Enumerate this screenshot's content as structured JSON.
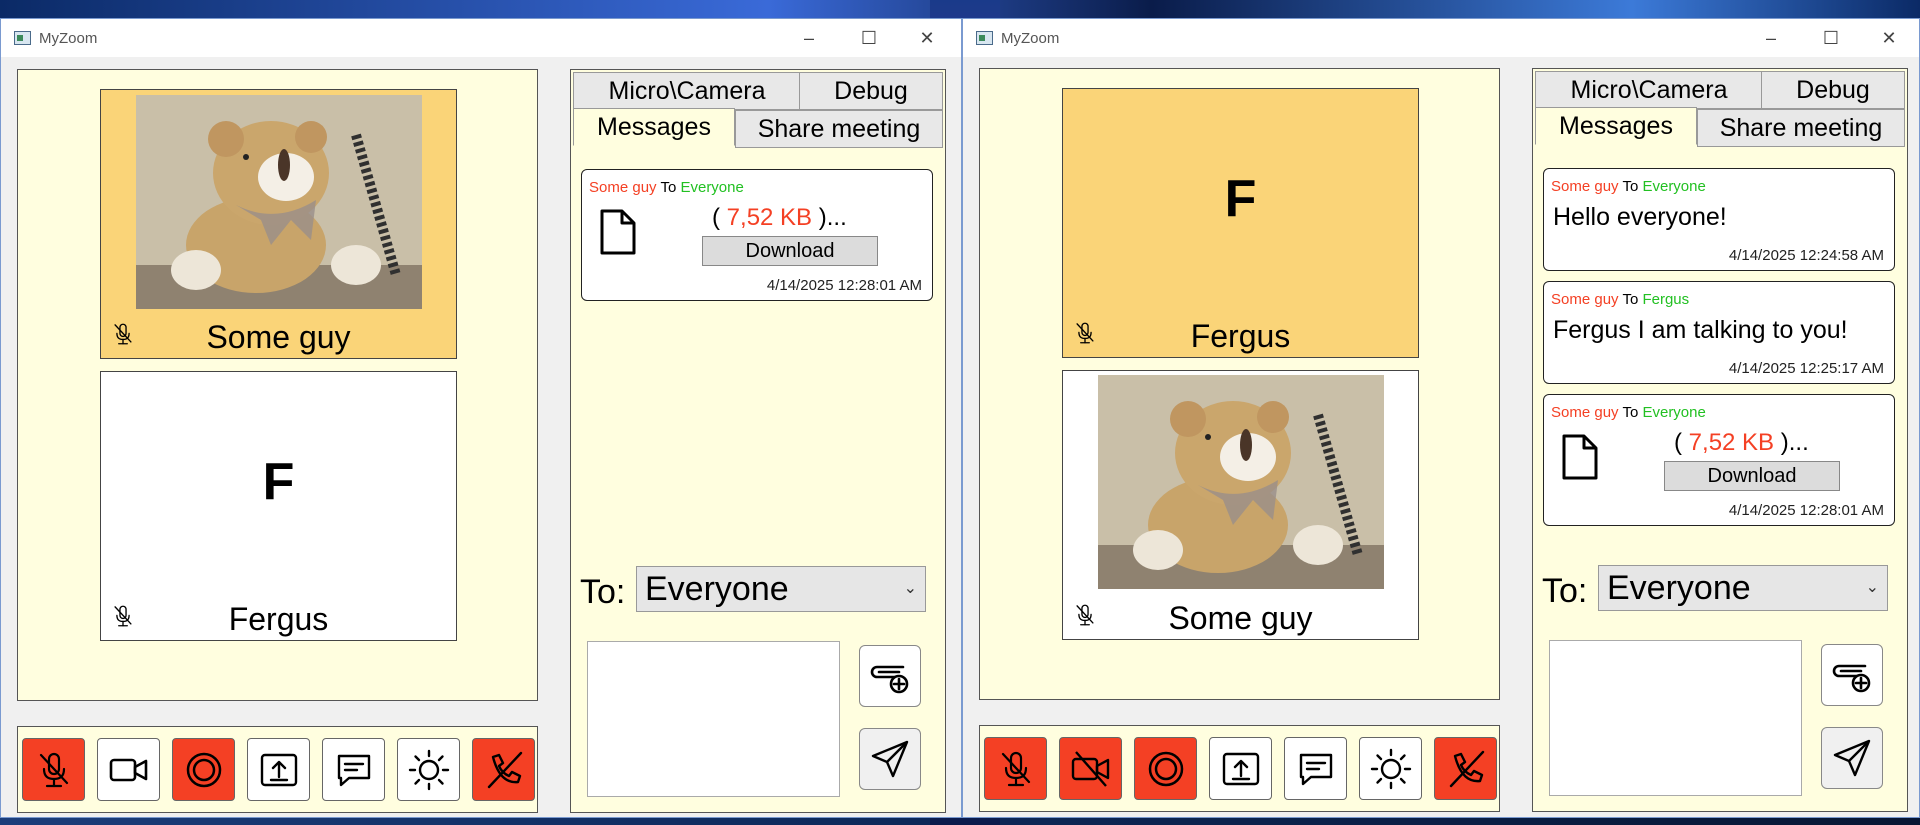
{
  "colors": {
    "active_tile": "#fad478",
    "panel_bg": "#fffedf",
    "danger": "#f44024",
    "sender": "#f44024",
    "recipient": "#22c022"
  },
  "windows": [
    {
      "title": "MyZoom",
      "tiles": [
        {
          "name": "Some guy",
          "type": "video",
          "letter": ""
        },
        {
          "name": "Fergus",
          "type": "avatar",
          "letter": "F"
        }
      ],
      "tabs": {
        "micro_camera": "Micro\\Camera",
        "debug": "Debug",
        "messages": "Messages",
        "share": "Share meeting"
      },
      "messages": [
        {
          "from": "Some guy",
          "to_word": "To",
          "target": "Everyone",
          "kind": "file",
          "size_open": "(",
          "size_value": "7,52 KB",
          "size_close": ")...",
          "download": "Download",
          "time": "4/14/2025 12:28:01 AM"
        }
      ],
      "to_label": "To:",
      "to_value": "Everyone",
      "controls": [
        "mic-off",
        "camera-on",
        "record",
        "share-screen",
        "chat",
        "brightness",
        "hang-up"
      ]
    },
    {
      "title": "MyZoom",
      "tiles": [
        {
          "name": "Fergus",
          "type": "avatar",
          "letter": "F"
        },
        {
          "name": "Some guy",
          "type": "video",
          "letter": ""
        }
      ],
      "tabs": {
        "micro_camera": "Micro\\Camera",
        "debug": "Debug",
        "messages": "Messages",
        "share": "Share meeting"
      },
      "messages": [
        {
          "from": "Some guy",
          "to_word": "To",
          "target": "Everyone",
          "kind": "text",
          "text": "Hello everyone!",
          "time": "4/14/2025 12:24:58 AM"
        },
        {
          "from": "Some guy",
          "to_word": "To",
          "target": "Fergus",
          "kind": "text",
          "text": "Fergus I am talking to you!",
          "time": "4/14/2025 12:25:17 AM"
        },
        {
          "from": "Some guy",
          "to_word": "To",
          "target": "Everyone",
          "kind": "file",
          "size_open": "(",
          "size_value": "7,52 KB",
          "size_close": ")...",
          "download": "Download",
          "time": "4/14/2025 12:28:01 AM"
        }
      ],
      "to_label": "To:",
      "to_value": "Everyone",
      "controls": [
        "mic-off",
        "camera-off",
        "record",
        "share-screen",
        "chat",
        "brightness",
        "hang-up"
      ]
    }
  ]
}
